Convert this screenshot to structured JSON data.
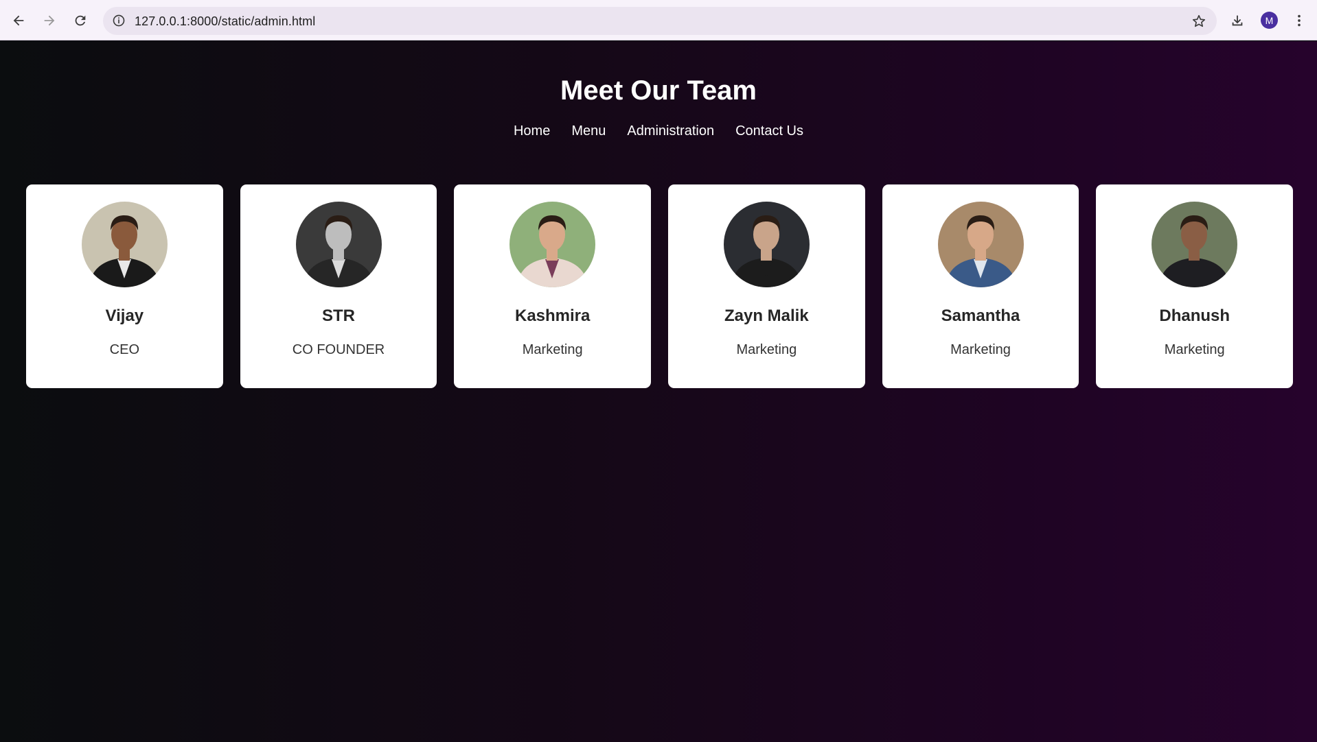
{
  "browser": {
    "url": "127.0.0.1:8000/static/admin.html",
    "profile_initial": "M"
  },
  "page": {
    "title": "Meet Our Team",
    "nav": [
      {
        "label": "Home"
      },
      {
        "label": "Menu"
      },
      {
        "label": "Administration"
      },
      {
        "label": "Contact Us"
      }
    ]
  },
  "team": [
    {
      "name": "Vijay",
      "role": "CEO",
      "photo_colors": {
        "bg": "#c9c3b0",
        "skin": "#8a5a3c",
        "suit": "#1a1a1a",
        "shirt": "#e8e8e8"
      }
    },
    {
      "name": "STR",
      "role": "CO FOUNDER",
      "photo_colors": {
        "bg": "#3a3a3a",
        "skin": "#bdbdbd",
        "suit": "#262626",
        "shirt": "#dcdcdc"
      }
    },
    {
      "name": "Kashmira",
      "role": "Marketing",
      "photo_colors": {
        "bg": "#8fb07a",
        "skin": "#d9a98a",
        "suit": "#e9d8d0",
        "shirt": "#7a3d5a"
      }
    },
    {
      "name": "Zayn Malik",
      "role": "Marketing",
      "photo_colors": {
        "bg": "#2b2d32",
        "skin": "#c9a48a",
        "suit": "#1c1c1c",
        "shirt": "#1c1c1c"
      }
    },
    {
      "name": "Samantha",
      "role": "Marketing",
      "photo_colors": {
        "bg": "#a88a6a",
        "skin": "#d7a888",
        "suit": "#3a5a88",
        "shirt": "#dfe6ee"
      }
    },
    {
      "name": "Dhanush",
      "role": "Marketing",
      "photo_colors": {
        "bg": "#6d7a5e",
        "skin": "#8a5e45",
        "suit": "#1e1e22",
        "shirt": "#1e1e22"
      }
    }
  ]
}
